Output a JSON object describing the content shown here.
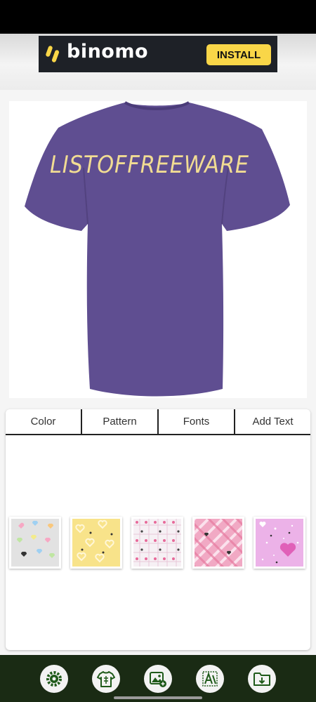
{
  "ad": {
    "brand": "binomo",
    "install_label": "INSTALL",
    "icon": "binomo-logo-icon"
  },
  "preview": {
    "shirt_text": "LISTOFFREEWARE",
    "shirt_color": "#5f4e91",
    "text_color": "#f1dc93"
  },
  "tabs": [
    {
      "label": "Color"
    },
    {
      "label": "Pattern"
    },
    {
      "label": "Fonts"
    },
    {
      "label": "Add Text"
    }
  ],
  "patterns": [
    {
      "name": "pastel-hearts",
      "background": "#e2e2e2"
    },
    {
      "name": "yellow-hearts",
      "background": "#f8e38a"
    },
    {
      "name": "pink-dots-grid",
      "background": "#f6f0f4"
    },
    {
      "name": "pink-plaid",
      "background": "#f1a9c4"
    },
    {
      "name": "pink-sparkle-hearts",
      "background": "#ecb2e8"
    }
  ],
  "bottom_nav": [
    {
      "icon": "gear-icon"
    },
    {
      "icon": "tshirt-icon"
    },
    {
      "icon": "add-image-icon"
    },
    {
      "icon": "text-design-icon"
    },
    {
      "icon": "save-folder-icon"
    }
  ],
  "colors": {
    "nav_background": "#1a2b14",
    "icon_color": "#1f5a1a",
    "install_button": "#f9d648"
  }
}
